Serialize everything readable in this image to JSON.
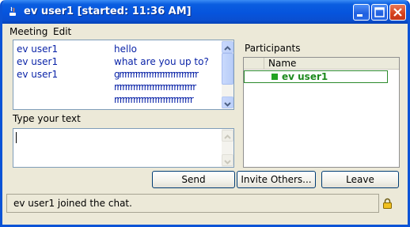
{
  "window": {
    "title": "ev user1 [started: 11:36 AM]"
  },
  "menu": [
    "Meeting",
    "Edit"
  ],
  "chat": {
    "rows": [
      {
        "user": "ev user1",
        "text": "hello"
      },
      {
        "user": "ev user1",
        "text": "what are you up to?"
      },
      {
        "user": "ev user1",
        "text": "grrrrrrrrrrrrrrrrrrrrrrrrrrrrr"
      },
      {
        "user": "",
        "text": "rrrrrrrrrrrrrrrrrrrrrrrrrrrrrr"
      },
      {
        "user": "",
        "text": "rrrrrrrrrrrrrrrrrrrrrrrrrrrrr"
      }
    ]
  },
  "compose": {
    "label": "Type your text",
    "value": ""
  },
  "participants": {
    "label": "Participants",
    "column": "Name",
    "items": [
      {
        "name": "ev user1",
        "status_color": "#22a322"
      }
    ]
  },
  "buttons": {
    "send": "Send",
    "invite": "Invite Others...",
    "leave": "Leave"
  },
  "status": {
    "text": "ev user1 joined the chat."
  },
  "colors": {
    "title_bar": "#0654dd",
    "chat_text": "#0b24a8",
    "participant_text": "#1d8a1d"
  }
}
